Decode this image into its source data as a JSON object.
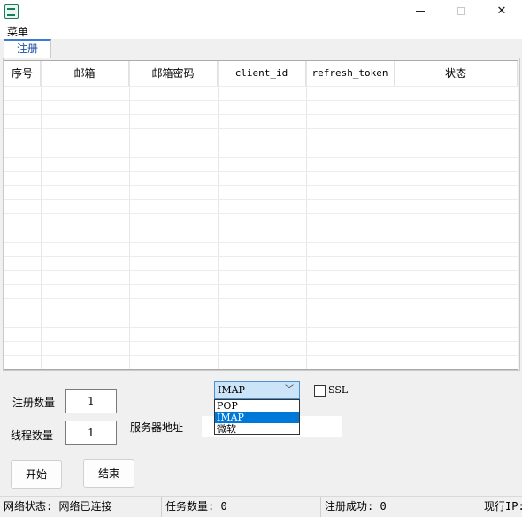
{
  "menubar": {
    "menu_label": "菜单"
  },
  "tabs": [
    {
      "label": "注册"
    }
  ],
  "table": {
    "columns": [
      "序号",
      "邮箱",
      "邮箱密码",
      "client_id",
      "refresh_token",
      "状态"
    ],
    "rows": []
  },
  "form": {
    "register_count_label": "注册数量",
    "register_count_value": "1",
    "thread_count_label": "线程数量",
    "thread_count_value": "1",
    "server_label": "服务器地址",
    "server_value": "",
    "protocol_selected": "IMAP",
    "protocol_options": [
      "POP",
      "IMAP",
      "微软"
    ],
    "ssl_label": "SSL",
    "ssl_checked": false,
    "start_button": "开始",
    "end_button": "结束"
  },
  "status": {
    "network": "网络状态: 网络已连接",
    "task_count": "任务数量: 0",
    "register_success": "注册成功: 0",
    "current_ip": "现行IP:"
  },
  "colors": {
    "tab_accent": "#3a7bd5",
    "selection_blue": "#0078d7",
    "combo_highlight": "#cce4f7"
  },
  "icons": {
    "app": "app-logo-icon",
    "minimize": "minimize-icon",
    "maximize": "maximize-icon",
    "close": "close-icon",
    "dropdown": "chevron-down-icon"
  }
}
